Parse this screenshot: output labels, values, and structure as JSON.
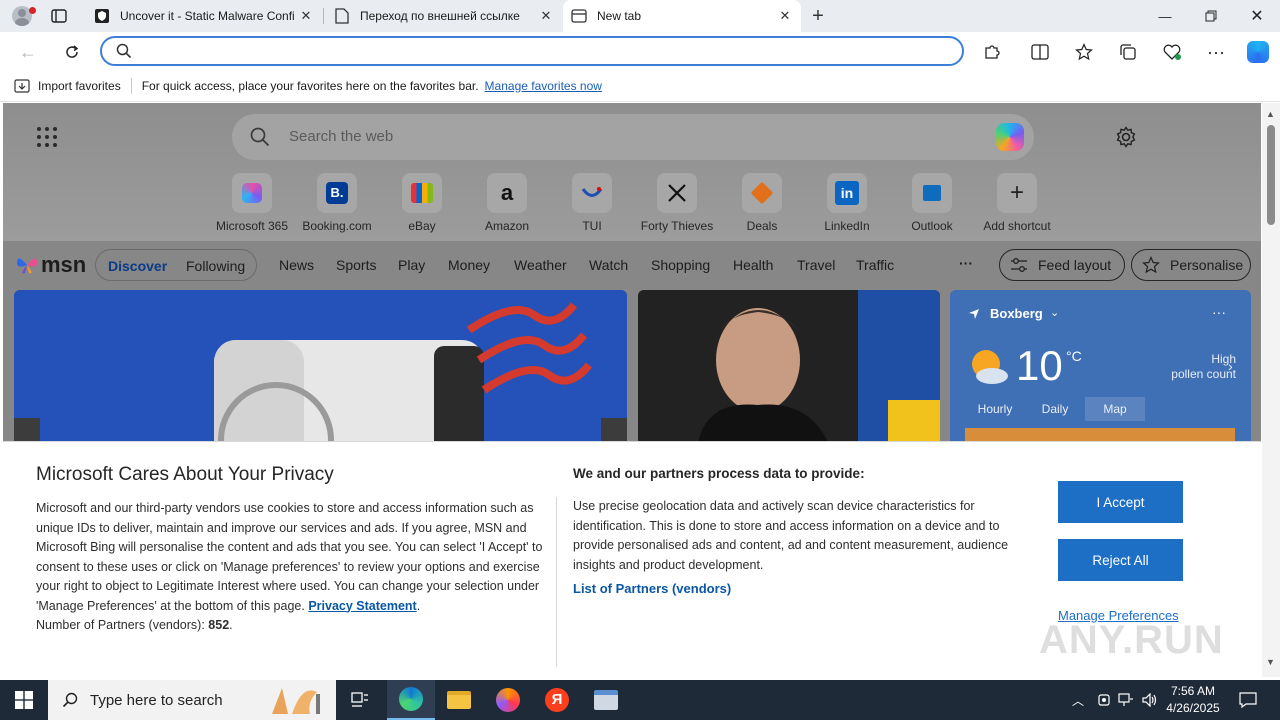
{
  "browser": {
    "tabs": [
      {
        "label": "Uncover it - Static Malware Confi",
        "icon": "shield-icon"
      },
      {
        "label": "Переход по внешней ссылке",
        "icon": "page-icon"
      },
      {
        "label": "New tab",
        "icon": "newtab-icon",
        "active": true
      }
    ],
    "address": {
      "value": "",
      "placeholder": ""
    },
    "favorites": {
      "import_label": "Import favorites",
      "hint": "For quick access, place your favorites here on the favorites bar.",
      "manage_link": "Manage favorites now"
    }
  },
  "newtab": {
    "search_placeholder": "Search the web",
    "shortcuts": [
      {
        "label": "Microsoft 365"
      },
      {
        "label": "Booking.com"
      },
      {
        "label": "eBay"
      },
      {
        "label": "Amazon"
      },
      {
        "label": "TUI"
      },
      {
        "label": "Forty Thieves"
      },
      {
        "label": "Deals"
      },
      {
        "label": "LinkedIn"
      },
      {
        "label": "Outlook"
      },
      {
        "label": "Add shortcut"
      }
    ],
    "msn": {
      "logo": "msn",
      "discover": "Discover",
      "following": "Following",
      "nav": [
        "News",
        "Sports",
        "Play",
        "Money",
        "Weather",
        "Watch",
        "Shopping",
        "Health",
        "Travel",
        "Traffic"
      ],
      "more": "···",
      "feed_layout": "Feed layout",
      "personalise": "Personalise"
    },
    "weather": {
      "location": "Boxberg",
      "temp": "10",
      "unit": "°C",
      "pollen_line1": "High",
      "pollen_line2": "pollen count",
      "tabs": [
        "Hourly",
        "Daily",
        "Map"
      ]
    }
  },
  "consent": {
    "title": "Microsoft Cares About Your Privacy",
    "body": "Microsoft and our third-party vendors use cookies to store and access information such as unique IDs to deliver, maintain and improve our services and ads. If you agree, MSN and Microsoft Bing will personalise the content and ads that you see. You can select 'I Accept' to consent to these uses or click on 'Manage preferences' to review your options and exercise your right to object to Legitimate Interest where used. You can change your selection under 'Manage Preferences' at the bottom of this page.",
    "privacy_link": "Privacy Statement",
    "partners_label": "Number of Partners (vendors):",
    "partners_count": "852",
    "subheading": "We and our partners process data to provide:",
    "body2": "Use precise geolocation data and actively scan device characteristics for identification. This is done to store and access information on a device and to provide personalised ads and content, ad and content measurement, audience insights and product development.",
    "partners_link": "List of Partners (vendors)",
    "accept": "I Accept",
    "reject": "Reject All",
    "manage": "Manage Preferences",
    "watermark": "ANY.RUN"
  },
  "taskbar": {
    "search_placeholder": "Type here to search",
    "time": "7:56 AM",
    "date": "4/26/2025"
  },
  "colors": {
    "accent": "#1d6fc6",
    "taskbar": "#1f2a38"
  }
}
